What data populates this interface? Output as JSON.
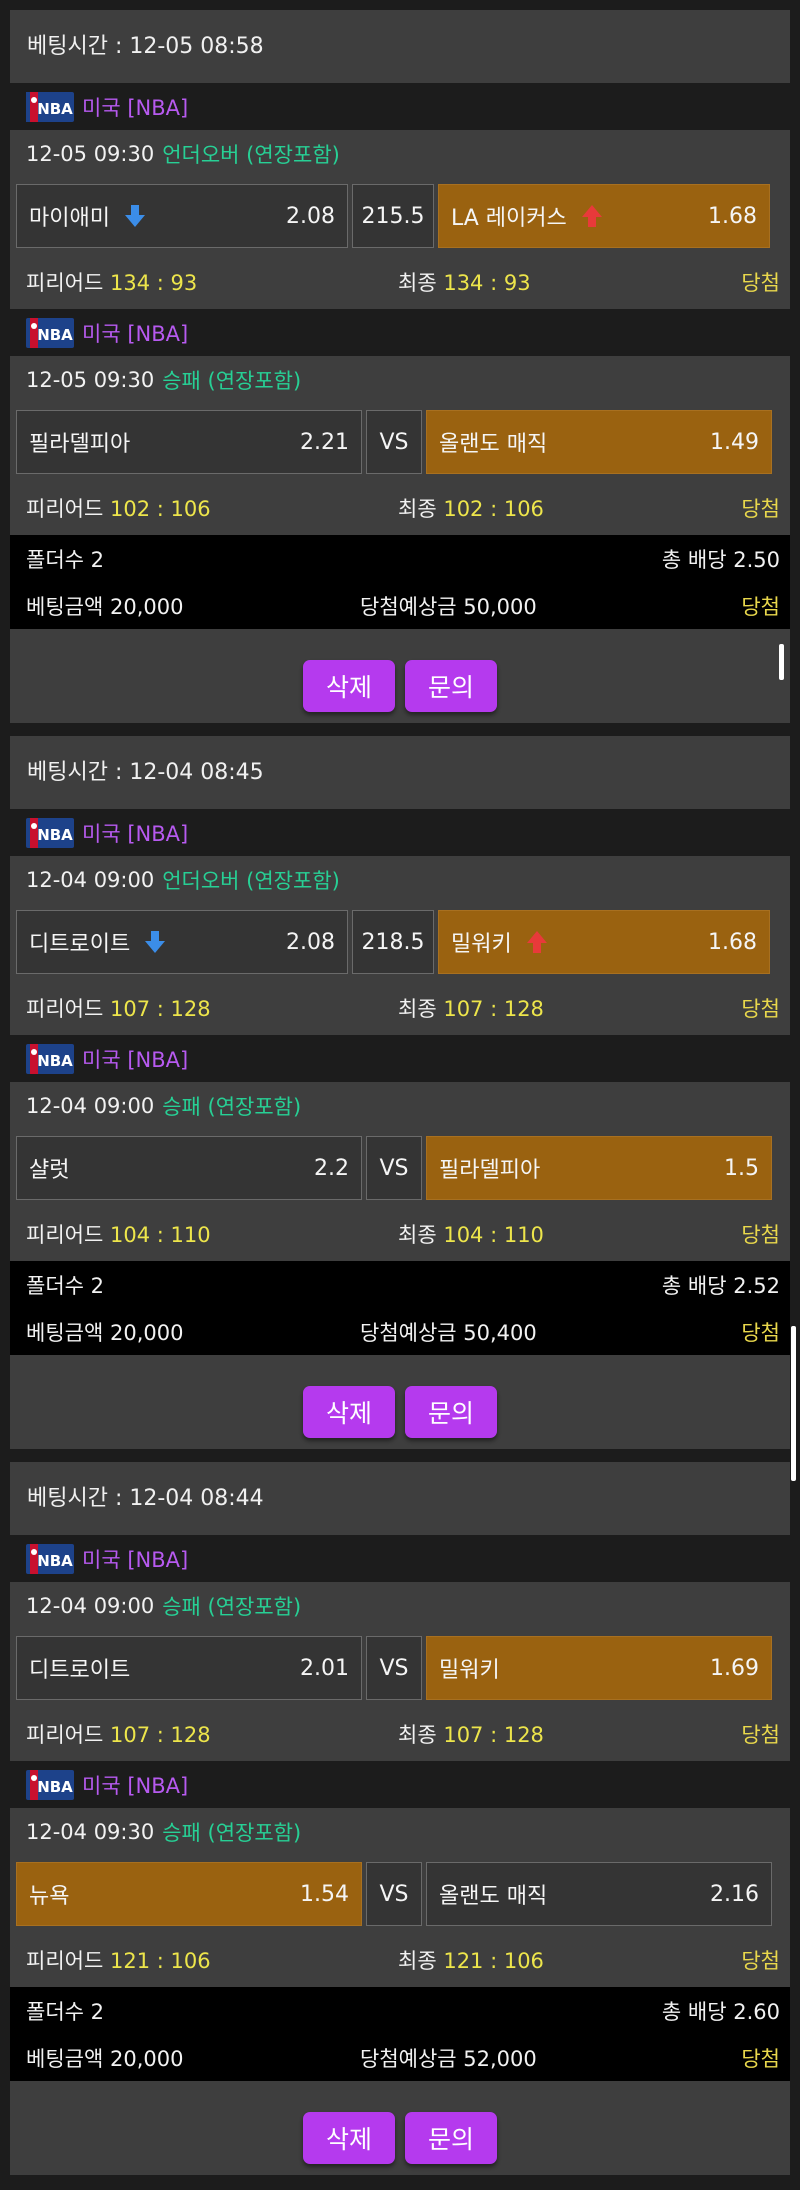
{
  "labels": {
    "betting_time": "베팅시간 : ",
    "period": "피리어드 ",
    "final": "최종 ",
    "folders": "폴더수 ",
    "total_odds": "총 배당 ",
    "bet_amount": "베팅금액 ",
    "expected_win": "당첨예상금 ",
    "win": "당첨",
    "delete_btn": "삭제",
    "inquiry_btn": "문의"
  },
  "colors": {
    "accent_purple": "#b53aee",
    "league_text": "#b75af0",
    "game_type": "#27d095",
    "score": "#ede54b",
    "selected_box": "#9a6210",
    "arrow_down": "#3b8de8",
    "arrow_up": "#e83a3a"
  },
  "bets": [
    {
      "time": "12-05 08:58",
      "games": [
        {
          "league_logo": "nba-logo-icon",
          "league": "미국 [NBA]",
          "datetime": "12-05 09:30",
          "type": "언더오버 (연장포함)",
          "home": "마이애미",
          "home_odds": "2.08",
          "home_icon": "arrow-down-icon",
          "mid": "215.5",
          "away": "LA 레이커스",
          "away_odds": "1.68",
          "away_icon": "arrow-up-icon",
          "selected": "away",
          "period_score": "134 : 93",
          "final_score": "134 : 93",
          "result": "당첨"
        },
        {
          "league_logo": "nba-logo-icon",
          "league": "미국 [NBA]",
          "datetime": "12-05 09:30",
          "type": "승패 (연장포함)",
          "home": "필라델피아",
          "home_odds": "2.21",
          "mid": "VS",
          "away": "올랜도 매직",
          "away_odds": "1.49",
          "selected": "away",
          "period_score": "102 : 106",
          "final_score": "102 : 106",
          "result": "당첨"
        }
      ],
      "folders": "2",
      "total_odds": "2.50",
      "amount": "20,000",
      "expected": "50,000",
      "result": "당첨"
    },
    {
      "time": "12-04 08:45",
      "games": [
        {
          "league_logo": "nba-logo-icon",
          "league": "미국 [NBA]",
          "datetime": "12-04 09:00",
          "type": "언더오버 (연장포함)",
          "home": "디트로이트",
          "home_odds": "2.08",
          "home_icon": "arrow-down-icon",
          "mid": "218.5",
          "away": "밀워키",
          "away_odds": "1.68",
          "away_icon": "arrow-up-icon",
          "selected": "away",
          "period_score": "107 : 128",
          "final_score": "107 : 128",
          "result": "당첨"
        },
        {
          "league_logo": "nba-logo-icon",
          "league": "미국 [NBA]",
          "datetime": "12-04 09:00",
          "type": "승패 (연장포함)",
          "home": "샬럿",
          "home_odds": "2.2",
          "mid": "VS",
          "away": "필라델피아",
          "away_odds": "1.5",
          "selected": "away",
          "period_score": "104 : 110",
          "final_score": "104 : 110",
          "result": "당첨"
        }
      ],
      "folders": "2",
      "total_odds": "2.52",
      "amount": "20,000",
      "expected": "50,400",
      "result": "당첨"
    },
    {
      "time": "12-04 08:44",
      "games": [
        {
          "league_logo": "nba-logo-icon",
          "league": "미국 [NBA]",
          "datetime": "12-04 09:00",
          "type": "승패 (연장포함)",
          "home": "디트로이트",
          "home_odds": "2.01",
          "mid": "VS",
          "away": "밀워키",
          "away_odds": "1.69",
          "selected": "away",
          "period_score": "107 : 128",
          "final_score": "107 : 128",
          "result": "당첨"
        },
        {
          "league_logo": "nba-logo-icon",
          "league": "미국 [NBA]",
          "datetime": "12-04 09:30",
          "type": "승패 (연장포함)",
          "home": "뉴욕",
          "home_odds": "1.54",
          "mid": "VS",
          "away": "올랜도 매직",
          "away_odds": "2.16",
          "selected": "home",
          "period_score": "121 : 106",
          "final_score": "121 : 106",
          "result": "당첨"
        }
      ],
      "folders": "2",
      "total_odds": "2.60",
      "amount": "20,000",
      "expected": "52,000",
      "result": "당첨"
    }
  ]
}
